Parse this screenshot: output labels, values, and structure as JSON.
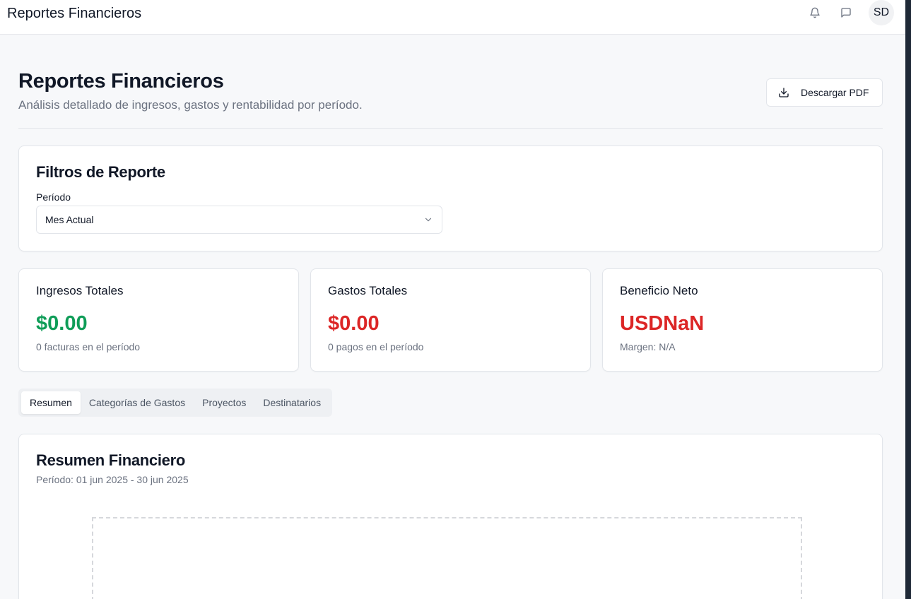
{
  "topbar": {
    "app_title": "Reportes Financieros",
    "user_initials": "SD"
  },
  "header": {
    "title": "Reportes Financieros",
    "subtitle": "Análisis detallado de ingresos, gastos y rentabilidad por período.",
    "download_label": "Descargar PDF"
  },
  "filters": {
    "title": "Filtros de Reporte",
    "period_label": "Período",
    "period_value": "Mes Actual"
  },
  "stats": {
    "income": {
      "title": "Ingresos Totales",
      "value": "$0.00",
      "sub": "0 facturas en el período",
      "color": "#0f9d58"
    },
    "expenses": {
      "title": "Gastos Totales",
      "value": "$0.00",
      "sub": "0 pagos en el período",
      "color": "#dc2626"
    },
    "net": {
      "title": "Beneficio Neto",
      "value": "USDNaN",
      "sub": "Margen: N/A",
      "color": "#dc2626"
    }
  },
  "tabs": [
    "Resumen",
    "Categorías de Gastos",
    "Proyectos",
    "Destinatarios"
  ],
  "summary": {
    "title": "Resumen Financiero",
    "period": "Período: 01 jun 2025 - 30 jun 2025"
  }
}
